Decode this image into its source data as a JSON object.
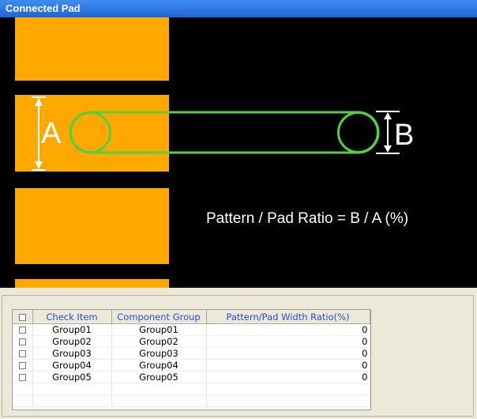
{
  "window": {
    "title": "Connected Pad"
  },
  "diagram": {
    "label_a": "A",
    "label_b": "B",
    "formula": "Pattern / Pad Ratio = B / A (%)",
    "colors": {
      "background": "#000000",
      "pad": "#ffa800",
      "pattern": "#55d045",
      "marker": "#ffffff"
    }
  },
  "table": {
    "headers": {
      "check_item": "Check Item",
      "component_group": "Component Group",
      "ratio": "Pattern/Pad Width Ratio(%)"
    },
    "rows": [
      {
        "check_item": "Group01",
        "component_group": "Group01",
        "ratio": "0"
      },
      {
        "check_item": "Group02",
        "component_group": "Group02",
        "ratio": "0"
      },
      {
        "check_item": "Group03",
        "component_group": "Group03",
        "ratio": "0"
      },
      {
        "check_item": "Group04",
        "component_group": "Group04",
        "ratio": "0"
      },
      {
        "check_item": "Group05",
        "component_group": "Group05",
        "ratio": "0"
      }
    ]
  }
}
